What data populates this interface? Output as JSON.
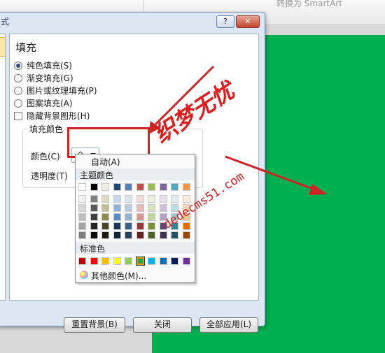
{
  "ribbon": {
    "right_text": "转换为 SmartArt"
  },
  "dialog": {
    "title": "式",
    "help_label": "?",
    "close_label": "✕",
    "section_title": "填充",
    "fill_options": [
      "纯色填充(S)",
      "渐变填充(G)",
      "图片或纹理填充(P)",
      "图案填充(A)"
    ],
    "hide_bg_label": "隐藏背景图形(H)",
    "group_title": "填充颜色",
    "color_label": "颜色(C)",
    "transparency_label": "透明度(T)",
    "buttons": {
      "reset": "重置背景(B)",
      "close": "关闭",
      "apply_all": "全部应用(L)"
    }
  },
  "palette": {
    "auto_label": "自动(A)",
    "theme_label": "主题颜色",
    "standard_label": "标准色",
    "more_label": "其他颜色(M)...",
    "theme_top": [
      "#ffffff",
      "#000000",
      "#eeece1",
      "#1f497d",
      "#4f81bd",
      "#c0504d",
      "#9bbb59",
      "#8064a2",
      "#4bacc6",
      "#f79646"
    ],
    "theme_tints": [
      [
        "#f2f2f2",
        "#7f7f7f",
        "#ddd9c3",
        "#c6d9f0",
        "#dbe5f1",
        "#f2dcdb",
        "#ebf1dd",
        "#e5e0ec",
        "#dbeef3",
        "#fdeada"
      ],
      [
        "#d8d8d8",
        "#595959",
        "#c4bd97",
        "#8db3e2",
        "#b8cce4",
        "#e5b9b7",
        "#d7e3bc",
        "#ccc1d9",
        "#b7dde8",
        "#fbd5b5"
      ],
      [
        "#bfbfbf",
        "#3f3f3f",
        "#938953",
        "#548dd4",
        "#95b3d7",
        "#d99694",
        "#c3d69b",
        "#b2a2c7",
        "#92cddc",
        "#fac08f"
      ],
      [
        "#a5a5a5",
        "#262626",
        "#494429",
        "#17365d",
        "#366092",
        "#953734",
        "#76923c",
        "#5f497a",
        "#31859b",
        "#e36c09"
      ],
      [
        "#7f7f7f",
        "#0c0c0c",
        "#1d1b10",
        "#0f243e",
        "#244061",
        "#632423",
        "#4f6128",
        "#3f3151",
        "#205867",
        "#974806"
      ]
    ],
    "standard": [
      "#c00000",
      "#ff0000",
      "#ffc000",
      "#ffff00",
      "#92d050",
      "#00b050",
      "#00b0f0",
      "#0070c0",
      "#002060",
      "#7030a0"
    ],
    "selected_standard_index": 5
  },
  "watermark": {
    "cn": "织梦无忧",
    "url": "dedecms51.com"
  },
  "colors": {
    "slide_fill": "#00b050",
    "arrow": "#d02424"
  }
}
